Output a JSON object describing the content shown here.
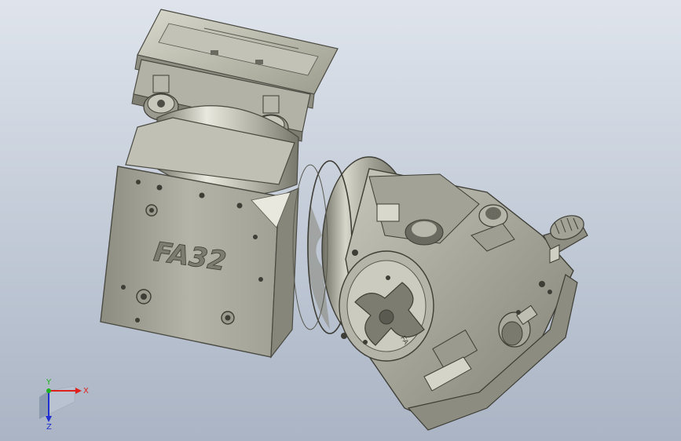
{
  "viewport": {
    "background_top": "#dfe4ec",
    "background_bottom": "#aab4c4"
  },
  "model": {
    "engraving_text": "FA32",
    "plate_text": "FA",
    "body_color": "#a9a99b",
    "shadow_color": "#6e6e64",
    "highlight_color": "#e6e6dc"
  },
  "triad": {
    "x_label": "X",
    "y_label": "Y",
    "z_label": "Z",
    "x_color": "#e0201c",
    "y_color": "#1fb11f",
    "z_color": "#2030d0"
  }
}
